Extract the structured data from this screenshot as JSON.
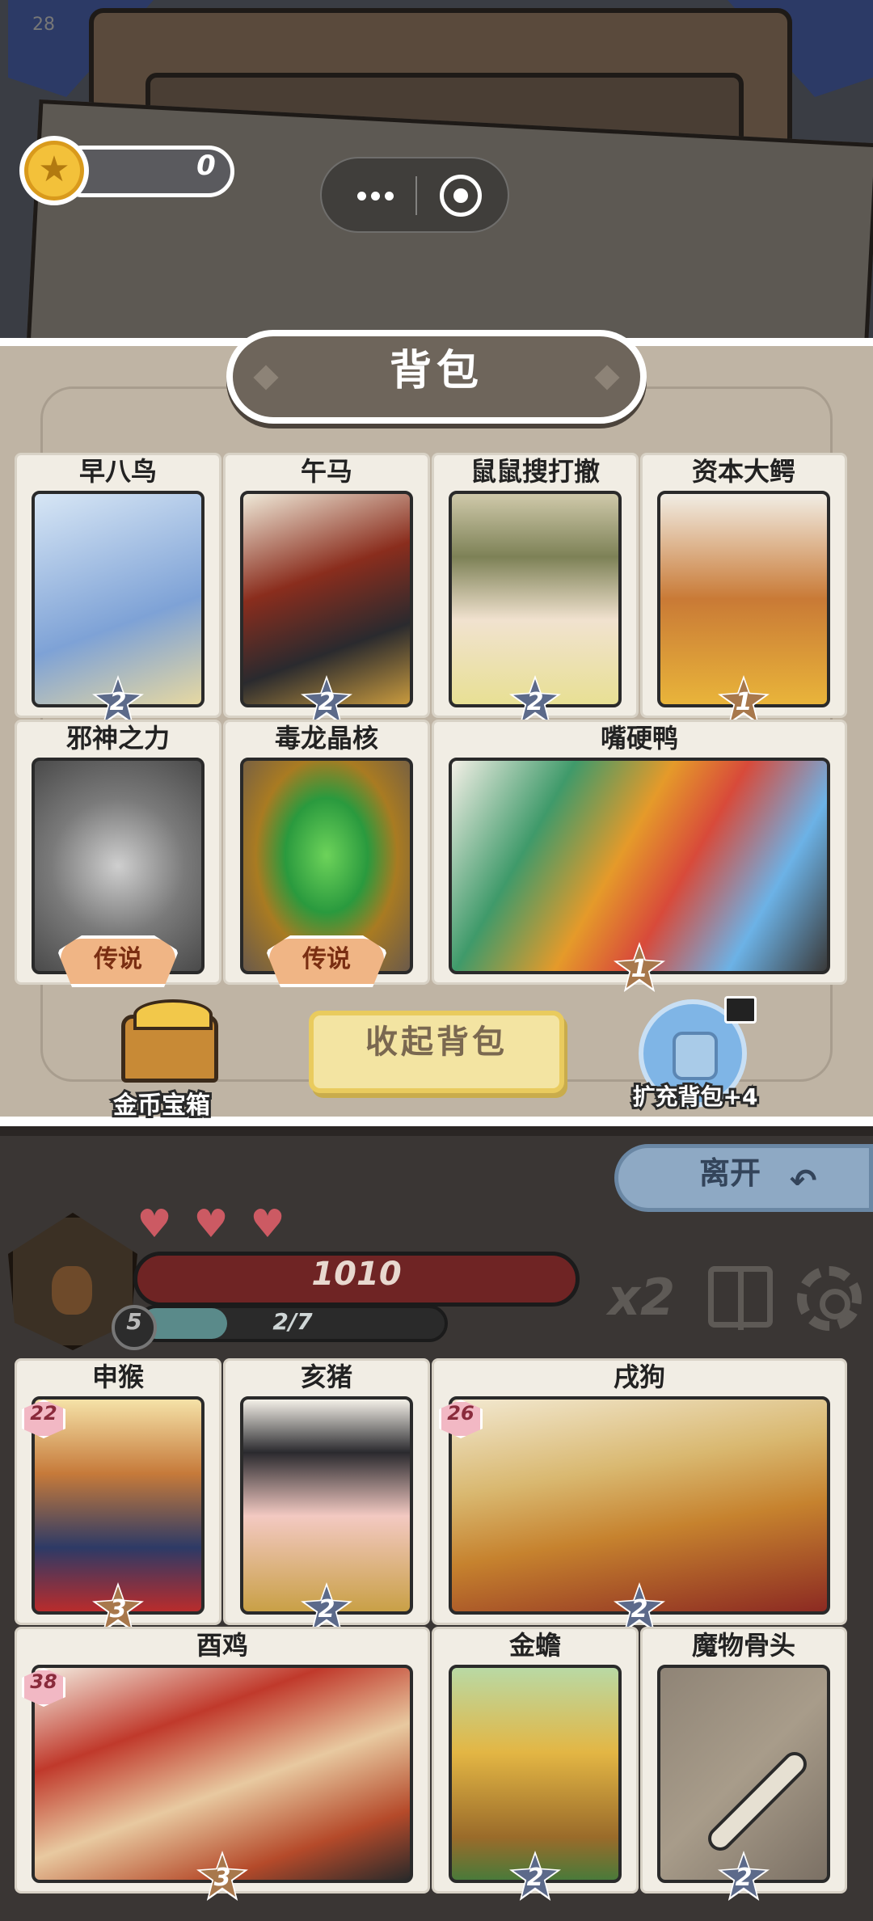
{
  "fps": "28",
  "coins": "0",
  "backpack": {
    "title": "背包",
    "items": [
      {
        "name": "早八鸟",
        "stars": "2"
      },
      {
        "name": "午马",
        "stars": "2"
      },
      {
        "name": "鼠鼠搜打撤",
        "stars": "2"
      },
      {
        "name": "资本大鳄",
        "stars": "1"
      },
      {
        "name": "邪神之力",
        "badge": "传说"
      },
      {
        "name": "毒龙晶核",
        "badge": "传说"
      },
      {
        "name": "嘴硬鸭",
        "stars": "1"
      }
    ],
    "chest_label": "金币宝箱",
    "collapse_label": "收起背包",
    "expand_label": "扩充背包+4"
  },
  "battle": {
    "leave_label": "离开",
    "hearts": 3,
    "hp": "1010",
    "level": "5",
    "xp": "2/7",
    "xp_fraction": 0.285,
    "speed": "x2",
    "team": [
      {
        "name": "申猴",
        "level": "22",
        "stars": "3"
      },
      {
        "name": "亥猪",
        "stars": "2"
      },
      {
        "name": "戌狗",
        "level": "26",
        "stars": "2"
      },
      {
        "name": "酉鸡",
        "level": "38",
        "stars": "3"
      },
      {
        "name": "金蟾",
        "stars": "2"
      },
      {
        "name": "魔物骨头",
        "stars": "2"
      }
    ]
  },
  "colors": {
    "panel": "#bfb4a4",
    "hp": "#6f2424",
    "coin": "#f3c13a",
    "accent": "#f3e4a2"
  }
}
